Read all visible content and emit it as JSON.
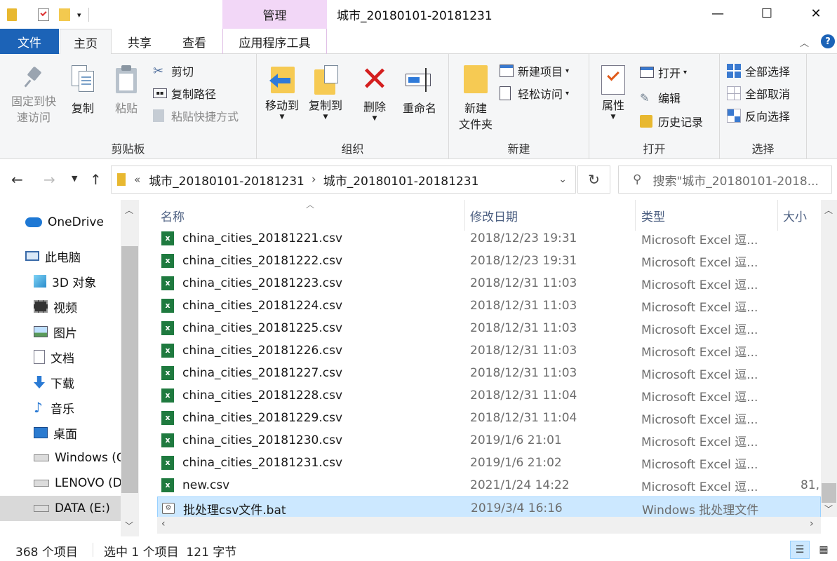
{
  "window": {
    "title": "城市_20180101-20181231",
    "contextual_tab_group": "管理",
    "controls": {
      "minimize": "—",
      "maximize": "☐",
      "close": "✕"
    }
  },
  "ribbon_tabs": {
    "file": "文件",
    "home": "主页",
    "share": "共享",
    "view": "查看",
    "app_tools": "应用程序工具"
  },
  "ribbon": {
    "clipboard": {
      "label": "剪贴板",
      "pin": "固定到快\n速访问",
      "copy": "复制",
      "paste": "粘贴",
      "cut": "剪切",
      "copy_path": "复制路径",
      "paste_shortcut": "粘贴快捷方式"
    },
    "organize": {
      "label": "组织",
      "move_to": "移动到",
      "copy_to": "复制到",
      "delete": "删除",
      "rename": "重命名"
    },
    "new": {
      "label": "新建",
      "new_folder": "新建\n文件夹",
      "new_item": "新建项目",
      "easy_access": "轻松访问"
    },
    "open": {
      "label": "打开",
      "properties": "属性",
      "open": "打开",
      "edit": "编辑",
      "history": "历史记录"
    },
    "select": {
      "label": "选择",
      "select_all": "全部选择",
      "select_none": "全部取消",
      "invert": "反向选择"
    }
  },
  "address": {
    "prefix": "«",
    "crumb1": "城市_20180101-20181231",
    "sep": "›",
    "crumb2": "城市_20180101-20181231",
    "search_placeholder": "搜索\"城市_20180101-2018..."
  },
  "nav_pane": [
    {
      "label": "OneDrive",
      "icon": "cloud-icon",
      "indent": 1
    },
    {
      "label": "此电脑",
      "icon": "pc-icon",
      "indent": 1
    },
    {
      "label": "3D 对象",
      "icon": "cube-icon",
      "indent": 2
    },
    {
      "label": "视频",
      "icon": "film-icon",
      "indent": 2
    },
    {
      "label": "图片",
      "icon": "picture-icon",
      "indent": 2
    },
    {
      "label": "文档",
      "icon": "document-icon",
      "indent": 2
    },
    {
      "label": "下载",
      "icon": "download-icon",
      "indent": 2
    },
    {
      "label": "音乐",
      "icon": "music-icon",
      "indent": 2
    },
    {
      "label": "桌面",
      "icon": "desktop-icon",
      "indent": 2
    },
    {
      "label": "Windows (C",
      "icon": "drive-icon",
      "indent": 2
    },
    {
      "label": "LENOVO (D",
      "icon": "drive-icon",
      "indent": 2
    },
    {
      "label": "DATA (E:)",
      "icon": "drive-icon",
      "indent": 2
    }
  ],
  "columns": {
    "name": "名称",
    "date": "修改日期",
    "type": "类型",
    "size": "大小"
  },
  "files": [
    {
      "name": "china_cities_20181221.csv",
      "date": "2018/12/23 19:31",
      "type": "Microsoft Excel 逗...",
      "size": ""
    },
    {
      "name": "china_cities_20181222.csv",
      "date": "2018/12/23 19:31",
      "type": "Microsoft Excel 逗...",
      "size": ""
    },
    {
      "name": "china_cities_20181223.csv",
      "date": "2018/12/31 11:03",
      "type": "Microsoft Excel 逗...",
      "size": ""
    },
    {
      "name": "china_cities_20181224.csv",
      "date": "2018/12/31 11:03",
      "type": "Microsoft Excel 逗...",
      "size": ""
    },
    {
      "name": "china_cities_20181225.csv",
      "date": "2018/12/31 11:03",
      "type": "Microsoft Excel 逗...",
      "size": ""
    },
    {
      "name": "china_cities_20181226.csv",
      "date": "2018/12/31 11:03",
      "type": "Microsoft Excel 逗...",
      "size": ""
    },
    {
      "name": "china_cities_20181227.csv",
      "date": "2018/12/31 11:03",
      "type": "Microsoft Excel 逗...",
      "size": ""
    },
    {
      "name": "china_cities_20181228.csv",
      "date": "2018/12/31 11:04",
      "type": "Microsoft Excel 逗...",
      "size": ""
    },
    {
      "name": "china_cities_20181229.csv",
      "date": "2018/12/31 11:04",
      "type": "Microsoft Excel 逗...",
      "size": ""
    },
    {
      "name": "china_cities_20181230.csv",
      "date": "2019/1/6 21:01",
      "type": "Microsoft Excel 逗...",
      "size": ""
    },
    {
      "name": "china_cities_20181231.csv",
      "date": "2019/1/6 21:02",
      "type": "Microsoft Excel 逗...",
      "size": ""
    },
    {
      "name": "new.csv",
      "date": "2021/1/24 14:22",
      "type": "Microsoft Excel 逗...",
      "size": "81,"
    },
    {
      "name": "批处理csv文件.bat",
      "date": "2019/3/4 16:16",
      "type": "Windows 批处理文件",
      "size": ""
    }
  ],
  "status": {
    "count": "368 个项目",
    "selection": "选中 1 个项目  121 字节"
  },
  "colors": {
    "file_tab": "#1c63b7",
    "manage_tab": "#f2d7f7",
    "selection": "#cce8ff",
    "header_text": "#4d6082"
  }
}
